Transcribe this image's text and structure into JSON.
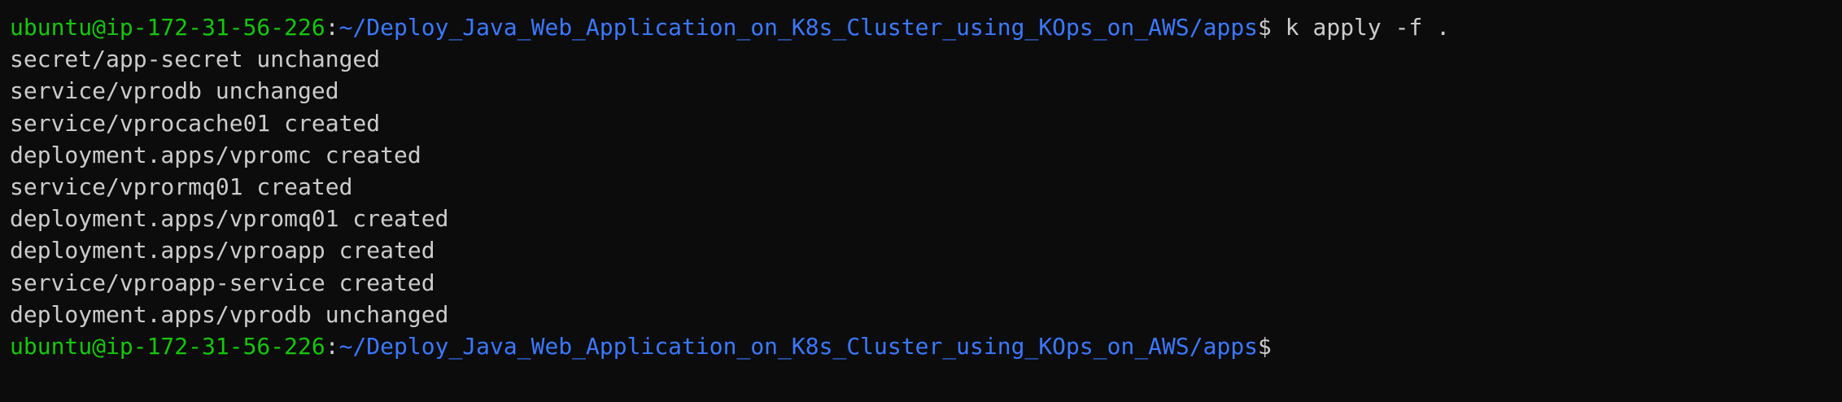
{
  "prompt": {
    "user_host": "ubuntu@ip-172-31-56-226",
    "separator": ":",
    "path": "~/Deploy_Java_Web_Application_on_K8s_Cluster_using_KOps_on_AWS/apps",
    "symbol": "$"
  },
  "command": " k apply -f .",
  "output": [
    "secret/app-secret unchanged",
    "service/vprodb unchanged",
    "service/vprocache01 created",
    "deployment.apps/vpromc created",
    "service/vprormq01 created",
    "deployment.apps/vpromq01 created",
    "deployment.apps/vproapp created",
    "service/vproapp-service created",
    "deployment.apps/vprodb unchanged"
  ],
  "colors": {
    "background": "#0c0c0c",
    "text": "#cccccc",
    "user_host": "#16c60c",
    "path": "#3b78ff"
  }
}
